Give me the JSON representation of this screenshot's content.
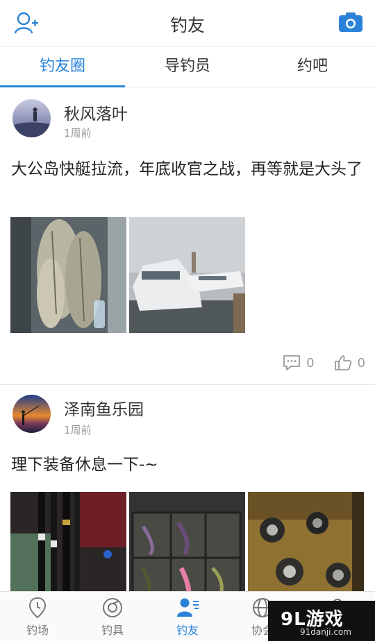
{
  "header": {
    "title": "钓友",
    "left_icon": "add-friend-icon",
    "right_icon": "camera-icon"
  },
  "tabs": [
    {
      "label": "钓友圈",
      "active": true
    },
    {
      "label": "导钓员",
      "active": false
    },
    {
      "label": "约吧",
      "active": false
    }
  ],
  "posts": [
    {
      "name": "秋风落叶",
      "time": "1周前",
      "content": "大公岛快艇拉流，年底收官之战，再等就是大头了",
      "photos": [
        "fish-photo",
        "boat-photo"
      ],
      "comment_count": "0",
      "like_count": "0"
    },
    {
      "name": "泽南鱼乐园",
      "time": "1周前",
      "content": "理下装备休息一下-~",
      "photos": [
        "rods-photo",
        "lures-photo",
        "reels-photo"
      ]
    }
  ],
  "bottom_nav": [
    {
      "label": "钓场",
      "icon": "location-pin-icon",
      "active": false
    },
    {
      "label": "钓具",
      "icon": "gear-icon",
      "active": false
    },
    {
      "label": "钓友",
      "icon": "friends-icon",
      "active": true
    },
    {
      "label": "协会",
      "icon": "globe-icon",
      "active": false
    },
    {
      "label": "",
      "icon": "profile-icon",
      "active": false
    }
  ],
  "watermark": {
    "main": "9L游戏",
    "sub": "91danji.com"
  },
  "colors": {
    "accent": "#2a83d9",
    "text": "#333333",
    "muted": "#999999"
  }
}
